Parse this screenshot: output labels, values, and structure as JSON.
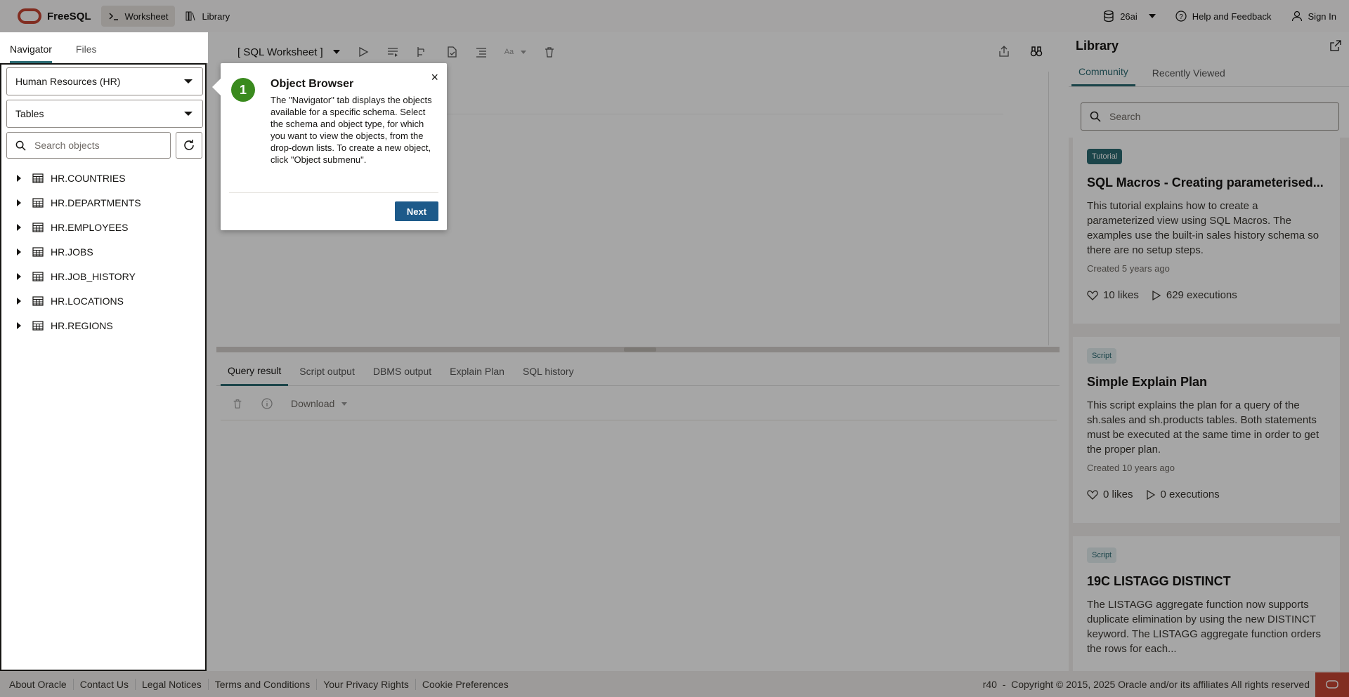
{
  "header": {
    "brand": "FreeSQL",
    "nav": [
      {
        "label": "Worksheet"
      },
      {
        "label": "Library"
      }
    ],
    "database": "26ai",
    "help": "Help and Feedback",
    "sign_in": "Sign In"
  },
  "navigator": {
    "tabs": [
      "Navigator",
      "Files"
    ],
    "schema": "Human Resources (HR)",
    "object_type": "Tables",
    "search_placeholder": "Search objects",
    "tables": [
      "HR.COUNTRIES",
      "HR.DEPARTMENTS",
      "HR.EMPLOYEES",
      "HR.JOBS",
      "HR.JOB_HISTORY",
      "HR.LOCATIONS",
      "HR.REGIONS"
    ]
  },
  "worksheet": {
    "title": "[ SQL Worksheet ]",
    "result_tabs": [
      "Query result",
      "Script output",
      "DBMS output",
      "Explain Plan",
      "SQL history"
    ],
    "download": "Download"
  },
  "library": {
    "title": "Library",
    "tabs": [
      "Community",
      "Recently Viewed"
    ],
    "search_placeholder": "Search",
    "cards": [
      {
        "badge": "Tutorial",
        "title": "SQL Macros - Creating parameterised...",
        "desc": "This tutorial explains how to create a parameterized view using SQL Macros. The examples use the built-in sales history schema so there are no setup steps.",
        "created": "Created 5 years ago",
        "likes": "10 likes",
        "executions": "629 executions"
      },
      {
        "badge": "Script",
        "title": "Simple Explain Plan",
        "desc": "This script explains the plan for a query of the sh.sales and sh.products tables. Both statements must be executed at the same time in order to get the proper plan.",
        "created": "Created 10 years ago",
        "likes": "0 likes",
        "executions": "0 executions"
      },
      {
        "badge": "Script",
        "title": "19C LISTAGG DISTINCT",
        "desc": "The LISTAGG aggregate function now supports duplicate elimination by using the new DISTINCT keyword. The LISTAGG aggregate function orders the rows for each..."
      }
    ]
  },
  "footer": {
    "links": [
      "About Oracle",
      "Contact Us",
      "Legal Notices",
      "Terms and Conditions",
      "Your Privacy Rights",
      "Cookie Preferences"
    ],
    "version": "r40",
    "copyright": "Copyright © 2015, 2025 Oracle and/or its affiliates All rights reserved"
  },
  "tour": {
    "step": "1",
    "title": "Object Browser",
    "body": "The \"Navigator\" tab displays the objects available for a specific schema. Select the schema and object type, for which you want to view the objects, from the drop-down lists. To create a new object, click \"Object submenu\".",
    "close": "×",
    "next": "Next"
  }
}
